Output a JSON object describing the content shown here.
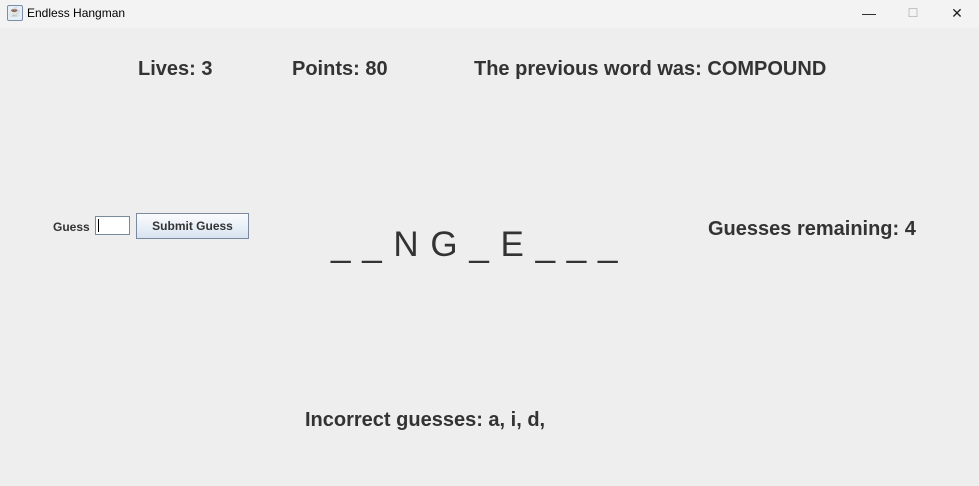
{
  "window": {
    "title": "Endless Hangman",
    "minimize": "—",
    "maximize": "☐",
    "close": "✕"
  },
  "status": {
    "lives": "Lives: 3",
    "points": "Points: 80",
    "previous_word": "The previous word was: COMPOUND"
  },
  "guess": {
    "label": "Guess",
    "value": "",
    "submit_label": "Submit Guess"
  },
  "word_display": "_ _ N G _ E _ _ _",
  "guesses_remaining": "Guesses remaining: 4",
  "incorrect_guesses": "Incorrect guesses: a, i, d,"
}
